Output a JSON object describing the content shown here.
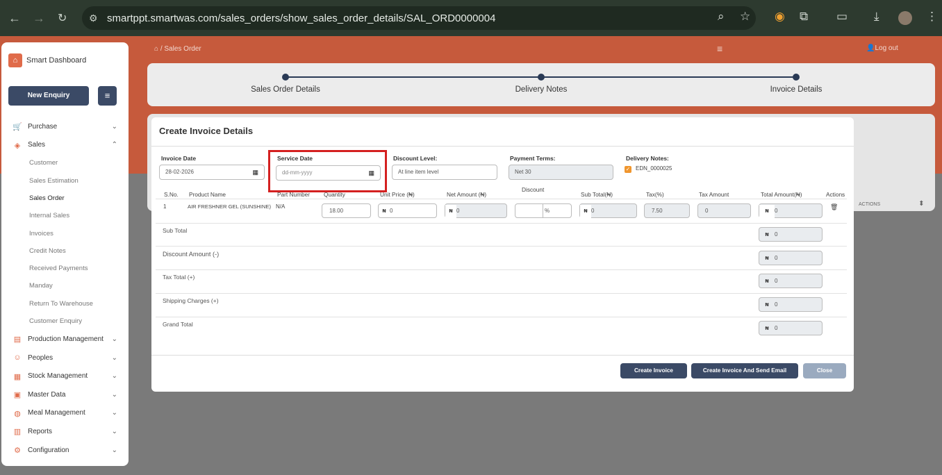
{
  "browser": {
    "url": "smartppt.smartwas.com/sales_orders/show_sales_order_details/SAL_ORD0000004"
  },
  "sidebar": {
    "brand": "Smart Dashboard",
    "new_enquiry": "New Enquiry",
    "menu": [
      {
        "label": "Purchase",
        "icon": "cart-icon",
        "expanded": false
      },
      {
        "label": "Sales",
        "icon": "bag-icon",
        "expanded": true
      }
    ],
    "sales_sub": [
      "Customer",
      "Sales Estimation",
      "Sales Order",
      "Internal Sales",
      "Invoices",
      "Credit Notes",
      "Received Payments",
      "Manday",
      "Return To Warehouse",
      "Customer Enquiry"
    ],
    "menu_after": [
      {
        "label": "Production Management",
        "icon": "factory-icon"
      },
      {
        "label": "Peoples",
        "icon": "people-icon"
      },
      {
        "label": "Stock Management",
        "icon": "box-icon"
      },
      {
        "label": "Master Data",
        "icon": "database-icon"
      },
      {
        "label": "Meal Management",
        "icon": "meal-icon"
      },
      {
        "label": "Reports",
        "icon": "report-icon"
      },
      {
        "label": "Configuration",
        "icon": "gear-icon"
      }
    ]
  },
  "header": {
    "breadcrumb": "Sales Order",
    "logout": "Log out"
  },
  "stepper": [
    "Sales Order Details",
    "Delivery Notes",
    "Invoice Details"
  ],
  "background_table": {
    "actions_header": "ACTIONS"
  },
  "modal": {
    "title": "Create Invoice Details",
    "invoice_date_label": "Invoice Date",
    "invoice_date": "28-02-2026",
    "service_date_label": "Service Date",
    "service_date_placeholder": "dd-mm-yyyy",
    "discount_level_label": "Discount Level:",
    "discount_level": "At line item level",
    "payment_terms_label": "Payment Terms:",
    "payment_terms": "Net 30",
    "delivery_notes_label": "Delivery Notes:",
    "delivery_note": "EDN_0000025",
    "columns": [
      "S.No.",
      "Product Name",
      "Part Number",
      "Quantity",
      "Unit Price (₦)",
      "Net Amount (₦)",
      "Discount",
      "Sub Total(₦)",
      "Tax(%)",
      "Tax Amount",
      "Total Amount(₦)",
      "Actions"
    ],
    "row": {
      "sno": "1",
      "product": "AIR FRESHNER GEL (SUNSHINE)",
      "part": "N/A",
      "quantity": "18.00",
      "unit_price": "0",
      "net_amount": "0",
      "discount_unit": "%",
      "sub_total": "0",
      "tax": "7.50",
      "tax_amount": "0",
      "total": "0"
    },
    "currency": "₦",
    "summary": [
      {
        "label": "Sub Total",
        "value": "0"
      },
      {
        "label": "Discount Amount (-)",
        "value": "0"
      },
      {
        "label": "Tax Total (+)",
        "value": "0"
      },
      {
        "label": "Shipping Charges (+)",
        "value": "0"
      },
      {
        "label": "Grand Total",
        "value": "0"
      }
    ],
    "buttons": {
      "create": "Create Invoice",
      "create_send": "Create Invoice And Send Email",
      "close": "Close"
    }
  }
}
